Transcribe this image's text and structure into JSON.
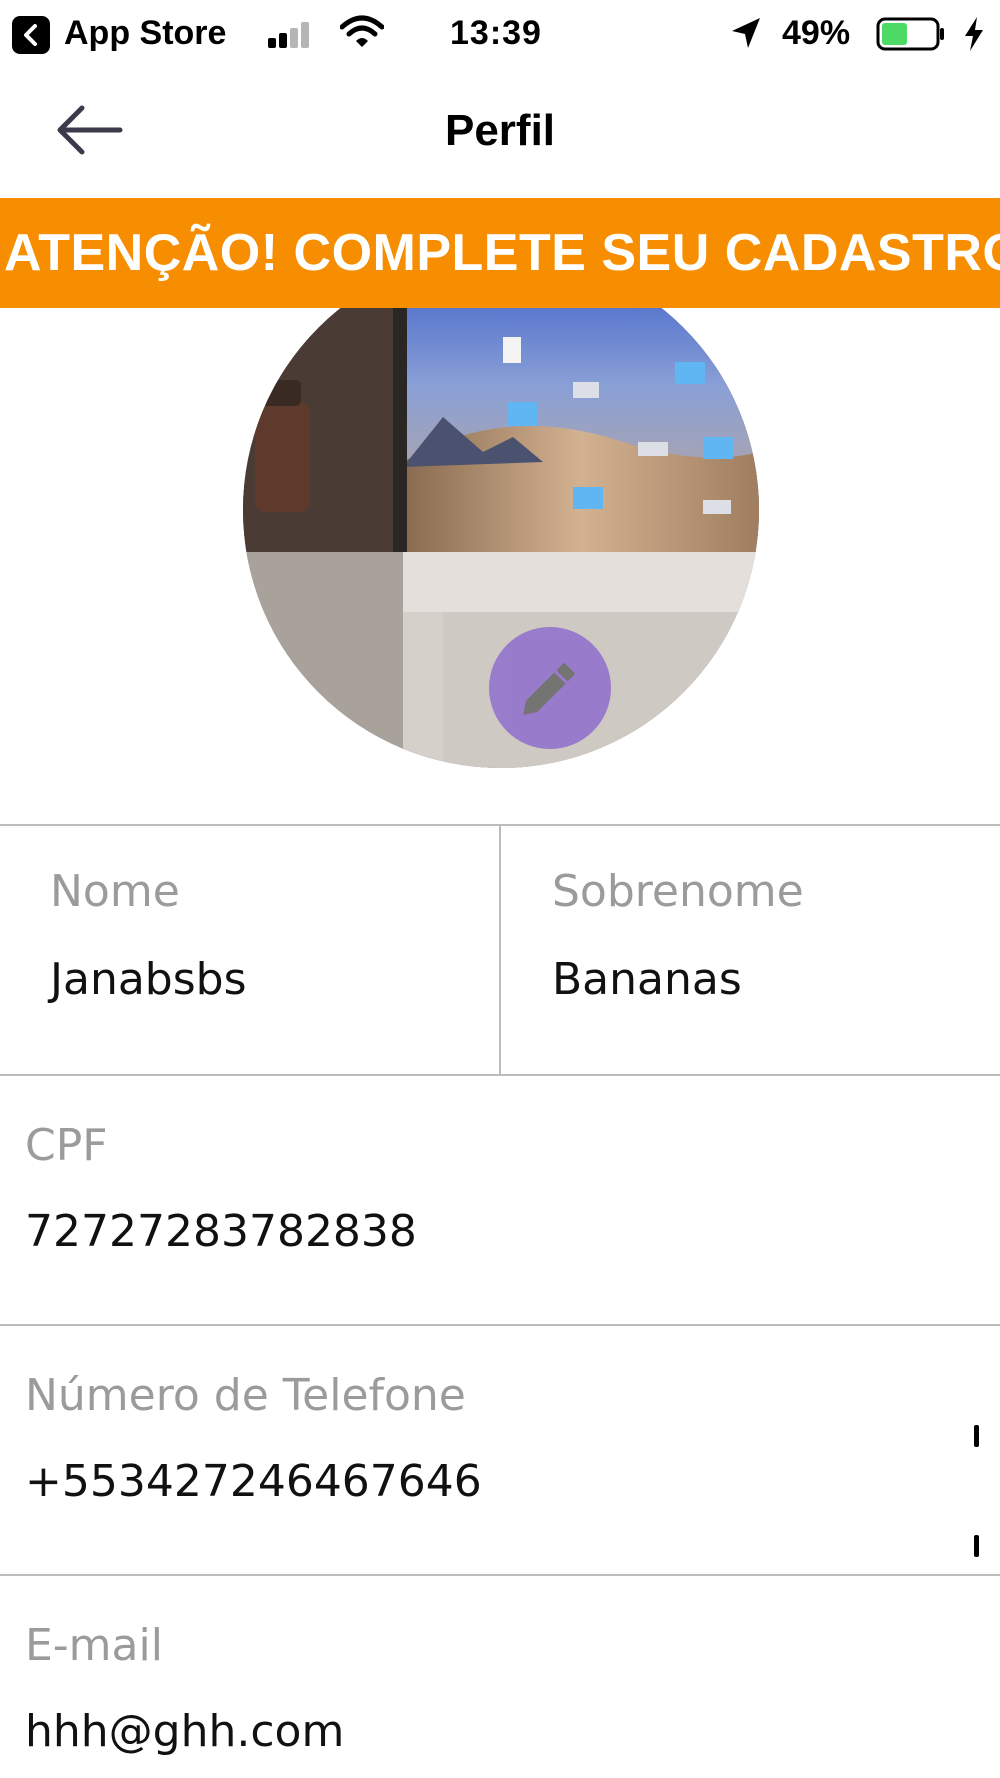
{
  "status_bar": {
    "back_app_label": "App Store",
    "time": "13:39",
    "battery_percent": "49%",
    "battery_level": 0.49,
    "battery_color": "#4cd964",
    "signal_bars_active": 2,
    "icons": [
      "back-chevron-icon",
      "signal-icon",
      "wifi-icon",
      "location-arrow-icon",
      "battery-icon",
      "charging-bolt-icon"
    ]
  },
  "nav": {
    "title": "Perfil",
    "back_icon": "arrow-left-icon"
  },
  "banner": {
    "text": "ATENÇÃO! COMPLETE SEU CADASTRO",
    "background_color": "#f78d00"
  },
  "avatar": {
    "edit_icon": "pencil-icon",
    "edit_button_color": "#9575cd"
  },
  "form": {
    "first_name": {
      "label": "Nome",
      "value": "Janabsbs"
    },
    "last_name": {
      "label": "Sobrenome",
      "value": "Bananas"
    },
    "cpf": {
      "label": "CPF",
      "value": "72727283782838"
    },
    "phone": {
      "label": "Número de Telefone",
      "value": "+553427246467646"
    },
    "email": {
      "label": "E-mail",
      "value": "hhh@ghh.com"
    }
  }
}
